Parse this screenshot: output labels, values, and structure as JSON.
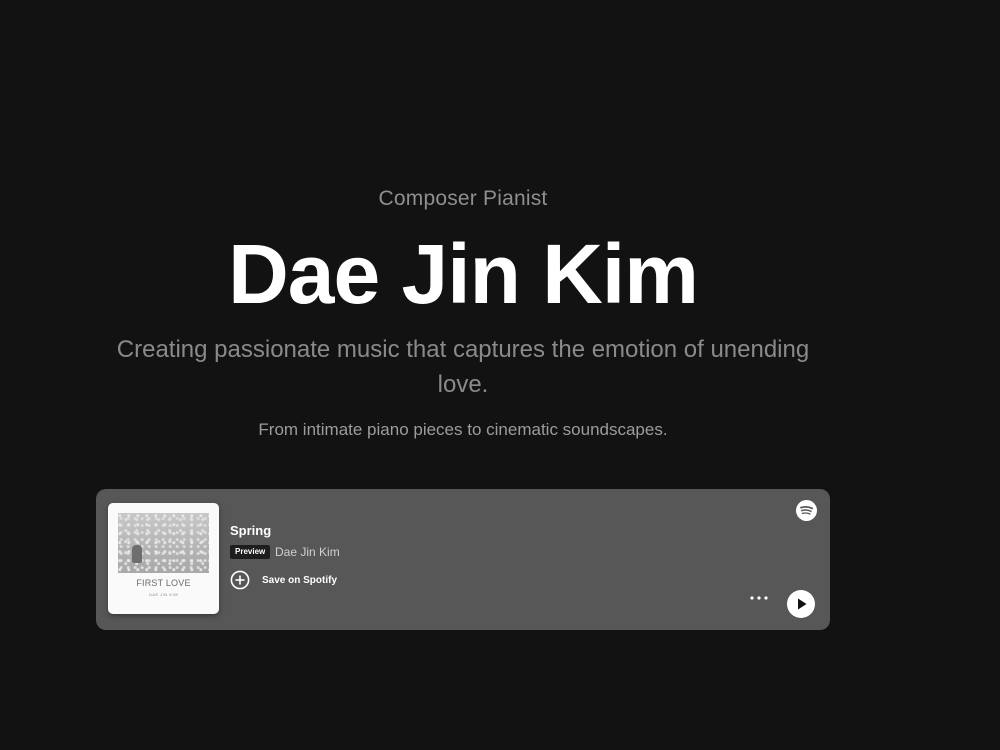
{
  "hero": {
    "kicker": "Composer Pianist",
    "name": "Dae Jin Kim",
    "tagline": "Creating passionate music that captures the emotion of unending love.",
    "subtext": "From intimate piano pieces to cinematic soundscapes."
  },
  "player": {
    "album_art": {
      "title": "FIRST LOVE",
      "artist": "DAE JIN KIM"
    },
    "track_title": "Spring",
    "badge": "Preview",
    "artist": "Dae Jin Kim",
    "save_label": "Save on Spotify",
    "icons": {
      "logo": "spotify-icon",
      "add": "plus-circle-icon",
      "more": "more-horizontal-icon",
      "play": "play-icon"
    },
    "colors": {
      "page_bg": "#121212",
      "card_bg": "#575757"
    }
  }
}
